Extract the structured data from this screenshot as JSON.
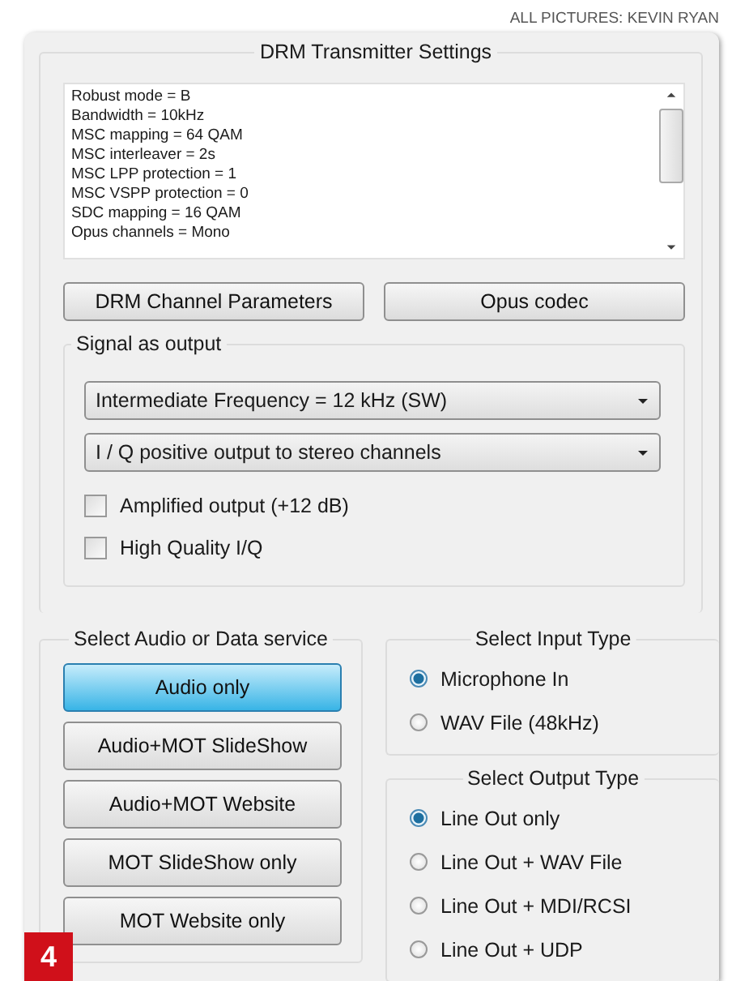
{
  "caption": "ALL PICTURES: KEVIN RYAN",
  "window": {
    "title": "DRM Transmitter Settings"
  },
  "settings_list": [
    "Robust mode = B",
    "Bandwidth = 10kHz",
    "MSC mapping = 64 QAM",
    "MSC interleaver = 2s",
    "MSC LPP protection = 1",
    "MSC VSPP protection = 0",
    "SDC mapping = 16 QAM",
    "Opus channels = Mono"
  ],
  "buttons": [
    "DRM Channel Parameters",
    "Opus codec"
  ],
  "signal_output": {
    "title": "Signal as output",
    "dropdowns": [
      {
        "value": "Intermediate Frequency = 12 kHz (SW)"
      },
      {
        "value": "I / Q positive output to stereo channels"
      }
    ],
    "checkboxes": [
      {
        "label": "Amplified output (+12 dB)",
        "checked": false
      },
      {
        "label": "High Quality I/Q",
        "checked": false
      }
    ]
  },
  "service": {
    "title": "Select Audio or Data service",
    "buttons": [
      {
        "label": "Audio only",
        "selected": true
      },
      {
        "label": "Audio+MOT SlideShow",
        "selected": false
      },
      {
        "label": "Audio+MOT Website",
        "selected": false
      },
      {
        "label": "MOT SlideShow only",
        "selected": false
      },
      {
        "label": "MOT Website only",
        "selected": false
      }
    ]
  },
  "input_type": {
    "title": "Select Input Type",
    "options": [
      {
        "label": "Microphone In",
        "selected": true
      },
      {
        "label": "WAV File (48kHz)",
        "selected": false
      }
    ]
  },
  "output_type": {
    "title": "Select Output Type",
    "options": [
      {
        "label": "Line Out only",
        "selected": true
      },
      {
        "label": "Line Out + WAV File",
        "selected": false
      },
      {
        "label": "Line Out + MDI/RCSI",
        "selected": false
      },
      {
        "label": "Line Out + UDP",
        "selected": false
      }
    ]
  },
  "figure_number": "4"
}
